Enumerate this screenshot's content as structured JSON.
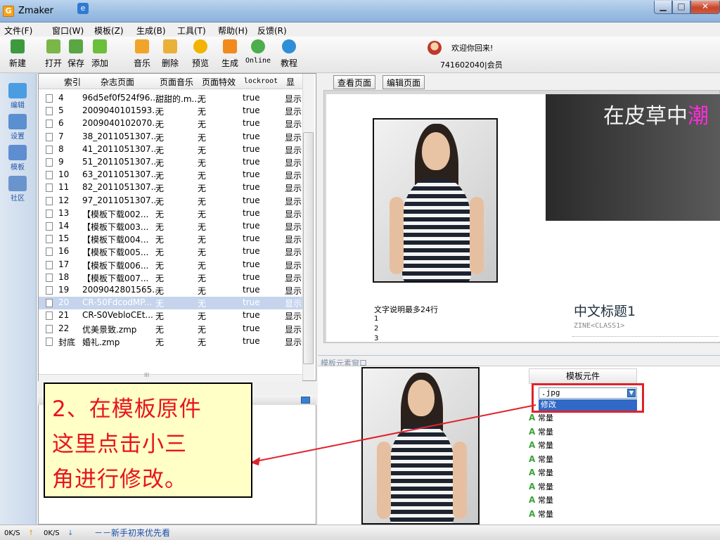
{
  "window": {
    "app_icon": "G",
    "title": "Zmaker",
    "minimize_glyph": "▁",
    "maximize_glyph": "□",
    "close_glyph": "✕"
  },
  "menu": [
    "文件(F)",
    "窗口(W)",
    "模板(Z)",
    "生成(B)",
    "工具(T)",
    "帮助(H)",
    "反馈(R)"
  ],
  "toolbar": [
    {
      "label": "新建",
      "icon": "new-page-icon",
      "color": "#3f9a3f"
    },
    {
      "label": "打开",
      "icon": "open-folder-icon",
      "color": "#7ab648"
    },
    {
      "label": "保存",
      "icon": "save-disk-icon",
      "color": "#5aa642"
    },
    {
      "label": "添加",
      "icon": "add-page-icon",
      "color": "#6bbf3a"
    },
    {
      "label": "音乐",
      "icon": "music-note-icon",
      "color": "#f0a52a"
    },
    {
      "label": "删除",
      "icon": "delete-icon",
      "color": "#e9b03a"
    },
    {
      "label": "预览",
      "icon": "star-icon",
      "color": "#f2b400"
    },
    {
      "label": "生成",
      "icon": "generate-icon",
      "color": "#f08a1c"
    },
    {
      "label": "Online",
      "icon": "online-icon",
      "color": "#4cae4c"
    },
    {
      "label": "教程",
      "icon": "help-icon",
      "color": "#2e8ed8"
    }
  ],
  "user": {
    "welcome": "欢迎你回来!",
    "member": "741602040|会员",
    "avatar_icon": "user-avatar-icon"
  },
  "side_nav": [
    {
      "label": "编辑",
      "icon": "edit-icon",
      "color": "#4a9de0"
    },
    {
      "label": "设置",
      "icon": "settings-icon",
      "color": "#5a8fd0"
    },
    {
      "label": "模板",
      "icon": "template-icon",
      "color": "#5e8ed1"
    },
    {
      "label": "社区",
      "icon": "community-icon",
      "color": "#6a95cc"
    }
  ],
  "file_table": {
    "headers": [
      "索引",
      "杂志页面",
      "页面音乐",
      "页面特效",
      "lockroot",
      "显"
    ],
    "rows": [
      [
        "4",
        "96d5ef0f524f96...",
        "甜甜的.m...",
        "无",
        "true",
        "显示"
      ],
      [
        "5",
        "2009040101593...",
        "无",
        "无",
        "true",
        "显示"
      ],
      [
        "6",
        "2009040102070...",
        "无",
        "无",
        "true",
        "显示"
      ],
      [
        "7",
        "38_2011051307...",
        "无",
        "无",
        "true",
        "显示"
      ],
      [
        "8",
        "41_2011051307...",
        "无",
        "无",
        "true",
        "显示"
      ],
      [
        "9",
        "51_2011051307...",
        "无",
        "无",
        "true",
        "显示"
      ],
      [
        "10",
        "63_2011051307...",
        "无",
        "无",
        "true",
        "显示"
      ],
      [
        "11",
        "82_2011051307...",
        "无",
        "无",
        "true",
        "显示"
      ],
      [
        "12",
        "97_2011051307...",
        "无",
        "无",
        "true",
        "显示"
      ],
      [
        "13",
        "【模板下载002...",
        "无",
        "无",
        "true",
        "显示"
      ],
      [
        "14",
        "【模板下载003...",
        "无",
        "无",
        "true",
        "显示"
      ],
      [
        "15",
        "【模板下载004...",
        "无",
        "无",
        "true",
        "显示"
      ],
      [
        "16",
        "【模板下载005...",
        "无",
        "无",
        "true",
        "显示"
      ],
      [
        "17",
        "【模板下载006...",
        "无",
        "无",
        "true",
        "显示"
      ],
      [
        "18",
        "【模板下载007...",
        "无",
        "无",
        "true",
        "显示"
      ],
      [
        "19",
        "2009042801565...",
        "无",
        "无",
        "true",
        "显示"
      ],
      [
        "20",
        "CR-50FdcodMP...",
        "无",
        "无",
        "true",
        "显示"
      ],
      [
        "21",
        "CR-S0VebloCEt...",
        "无",
        "无",
        "true",
        "显示"
      ],
      [
        "22",
        "优美景致.zmp",
        "无",
        "无",
        "true",
        "显示"
      ],
      [
        "封底",
        "婚礼.zmp",
        "无",
        "无",
        "true",
        "显示"
      ]
    ],
    "selected_index": "20",
    "hscroll_grip": "III"
  },
  "right_tabs": [
    "查看页面",
    "编辑页面"
  ],
  "preview": {
    "banner_text": "在皮草中",
    "banner_accent": "潮",
    "caption_label": "文字说明最多24行",
    "caption_lines": [
      "1",
      "2",
      "3"
    ],
    "cn_title": "中文标题1",
    "zine_class": "ZINE<CLASS1>"
  },
  "element_window": {
    "label": "模板元素窗口",
    "components_header": "模板元件",
    "select_value": ".jpg",
    "dropdown_option": "修改",
    "items": [
      "常量",
      "常量",
      "常量",
      "常量",
      "常量",
      "常量",
      "常量",
      "常量"
    ]
  },
  "callout": {
    "lines": [
      "2、在模板原件",
      "这里点击小三",
      "角进行修改。"
    ],
    "border_color": "#e0222a"
  },
  "status": {
    "up_speed": "0K/S",
    "down_speed": "0K/S",
    "ie_glyph": "e",
    "message": "－－新手初来优先看"
  }
}
